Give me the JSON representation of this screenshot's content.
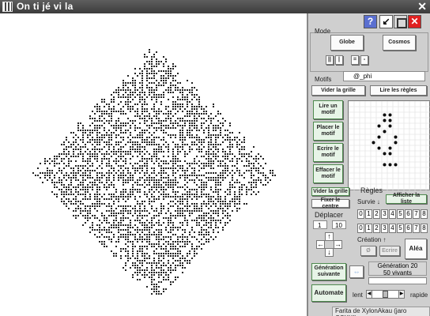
{
  "window": {
    "title": "On ti jé vi la"
  },
  "panel": {
    "mode_label": "Mode",
    "globe_label": "Globe",
    "cosmos_label": "Cosmos",
    "small_buttons": [
      "||",
      "|",
      "=",
      "-"
    ],
    "motifs_label": "Motifs",
    "motif_name": "@_phi",
    "vider_grille": "Vider la grille",
    "lire_regles": "Lire les règles",
    "lire_motif": "Lire un motif",
    "placer_motif": "Placer le motif",
    "ecrire_motif": "Ecrire le motif",
    "effacer_motif": "Effacer le motif",
    "vider_grille2": "Vider la grille",
    "fixer_centre": "Fixer le centre",
    "deplacer_label": "Déplacer",
    "deplacer_value1": "1",
    "deplacer_value2": "10",
    "regles_label": "Règles",
    "survie_label": "Survie ↓",
    "afficher_liste": "Afficher la liste",
    "survie_digits": [
      "0",
      "1",
      "2",
      "3",
      "4",
      "5",
      "6",
      "7",
      "8"
    ],
    "creation_label": "Création ↑",
    "creation_digits": [
      "0",
      "1",
      "2",
      "3",
      "4",
      "5",
      "6",
      "7",
      "8"
    ],
    "empty_set": "Ø",
    "ecrire": "Ecrire",
    "aleat": "Aléa",
    "generation_suivante": "Génération suivante",
    "generation_text": "Génération 20",
    "vivants_text": "50 vivants",
    "automate": "Automate",
    "lent": "lent",
    "rapide": "rapide",
    "credit": "Farita de  XylonAkau  (jaro CCXXI)"
  },
  "icons": {
    "help": "?",
    "minimize": "↙",
    "close": "✕"
  },
  "colors": {
    "accent_green": "#4f8a4f",
    "close_red": "#e02020",
    "help_blue": "#5a6fd0"
  }
}
